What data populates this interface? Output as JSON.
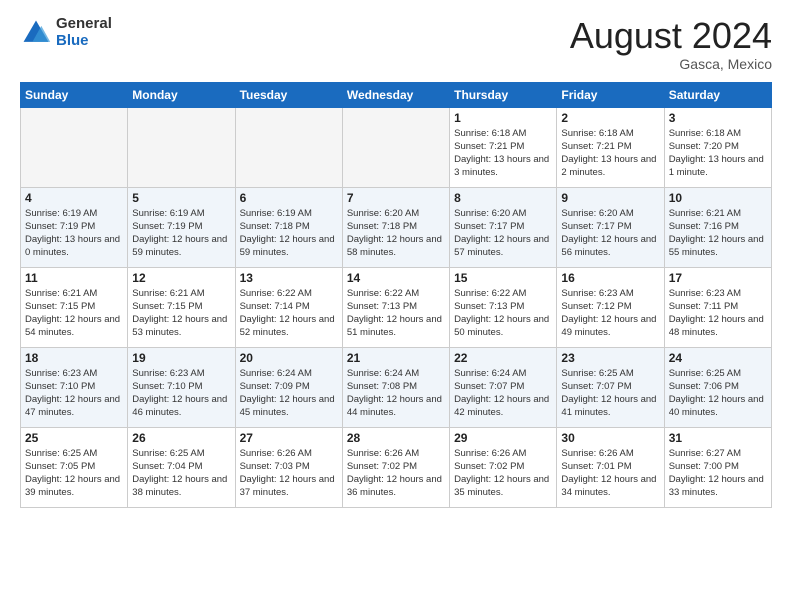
{
  "header": {
    "logo_general": "General",
    "logo_blue": "Blue",
    "month_title": "August 2024",
    "location": "Gasca, Mexico"
  },
  "days_of_week": [
    "Sunday",
    "Monday",
    "Tuesday",
    "Wednesday",
    "Thursday",
    "Friday",
    "Saturday"
  ],
  "weeks": [
    [
      {
        "day": "",
        "empty": true
      },
      {
        "day": "",
        "empty": true
      },
      {
        "day": "",
        "empty": true
      },
      {
        "day": "",
        "empty": true
      },
      {
        "day": "1",
        "sunrise": "6:18 AM",
        "sunset": "7:21 PM",
        "daylight": "13 hours and 3 minutes."
      },
      {
        "day": "2",
        "sunrise": "6:18 AM",
        "sunset": "7:21 PM",
        "daylight": "13 hours and 2 minutes."
      },
      {
        "day": "3",
        "sunrise": "6:18 AM",
        "sunset": "7:20 PM",
        "daylight": "13 hours and 1 minute."
      }
    ],
    [
      {
        "day": "4",
        "sunrise": "6:19 AM",
        "sunset": "7:19 PM",
        "daylight": "13 hours and 0 minutes."
      },
      {
        "day": "5",
        "sunrise": "6:19 AM",
        "sunset": "7:19 PM",
        "daylight": "12 hours and 59 minutes."
      },
      {
        "day": "6",
        "sunrise": "6:19 AM",
        "sunset": "7:18 PM",
        "daylight": "12 hours and 59 minutes."
      },
      {
        "day": "7",
        "sunrise": "6:20 AM",
        "sunset": "7:18 PM",
        "daylight": "12 hours and 58 minutes."
      },
      {
        "day": "8",
        "sunrise": "6:20 AM",
        "sunset": "7:17 PM",
        "daylight": "12 hours and 57 minutes."
      },
      {
        "day": "9",
        "sunrise": "6:20 AM",
        "sunset": "7:17 PM",
        "daylight": "12 hours and 56 minutes."
      },
      {
        "day": "10",
        "sunrise": "6:21 AM",
        "sunset": "7:16 PM",
        "daylight": "12 hours and 55 minutes."
      }
    ],
    [
      {
        "day": "11",
        "sunrise": "6:21 AM",
        "sunset": "7:15 PM",
        "daylight": "12 hours and 54 minutes."
      },
      {
        "day": "12",
        "sunrise": "6:21 AM",
        "sunset": "7:15 PM",
        "daylight": "12 hours and 53 minutes."
      },
      {
        "day": "13",
        "sunrise": "6:22 AM",
        "sunset": "7:14 PM",
        "daylight": "12 hours and 52 minutes."
      },
      {
        "day": "14",
        "sunrise": "6:22 AM",
        "sunset": "7:13 PM",
        "daylight": "12 hours and 51 minutes."
      },
      {
        "day": "15",
        "sunrise": "6:22 AM",
        "sunset": "7:13 PM",
        "daylight": "12 hours and 50 minutes."
      },
      {
        "day": "16",
        "sunrise": "6:23 AM",
        "sunset": "7:12 PM",
        "daylight": "12 hours and 49 minutes."
      },
      {
        "day": "17",
        "sunrise": "6:23 AM",
        "sunset": "7:11 PM",
        "daylight": "12 hours and 48 minutes."
      }
    ],
    [
      {
        "day": "18",
        "sunrise": "6:23 AM",
        "sunset": "7:10 PM",
        "daylight": "12 hours and 47 minutes."
      },
      {
        "day": "19",
        "sunrise": "6:23 AM",
        "sunset": "7:10 PM",
        "daylight": "12 hours and 46 minutes."
      },
      {
        "day": "20",
        "sunrise": "6:24 AM",
        "sunset": "7:09 PM",
        "daylight": "12 hours and 45 minutes."
      },
      {
        "day": "21",
        "sunrise": "6:24 AM",
        "sunset": "7:08 PM",
        "daylight": "12 hours and 44 minutes."
      },
      {
        "day": "22",
        "sunrise": "6:24 AM",
        "sunset": "7:07 PM",
        "daylight": "12 hours and 42 minutes."
      },
      {
        "day": "23",
        "sunrise": "6:25 AM",
        "sunset": "7:07 PM",
        "daylight": "12 hours and 41 minutes."
      },
      {
        "day": "24",
        "sunrise": "6:25 AM",
        "sunset": "7:06 PM",
        "daylight": "12 hours and 40 minutes."
      }
    ],
    [
      {
        "day": "25",
        "sunrise": "6:25 AM",
        "sunset": "7:05 PM",
        "daylight": "12 hours and 39 minutes."
      },
      {
        "day": "26",
        "sunrise": "6:25 AM",
        "sunset": "7:04 PM",
        "daylight": "12 hours and 38 minutes."
      },
      {
        "day": "27",
        "sunrise": "6:26 AM",
        "sunset": "7:03 PM",
        "daylight": "12 hours and 37 minutes."
      },
      {
        "day": "28",
        "sunrise": "6:26 AM",
        "sunset": "7:02 PM",
        "daylight": "12 hours and 36 minutes."
      },
      {
        "day": "29",
        "sunrise": "6:26 AM",
        "sunset": "7:02 PM",
        "daylight": "12 hours and 35 minutes."
      },
      {
        "day": "30",
        "sunrise": "6:26 AM",
        "sunset": "7:01 PM",
        "daylight": "12 hours and 34 minutes."
      },
      {
        "day": "31",
        "sunrise": "6:27 AM",
        "sunset": "7:00 PM",
        "daylight": "12 hours and 33 minutes."
      }
    ]
  ]
}
